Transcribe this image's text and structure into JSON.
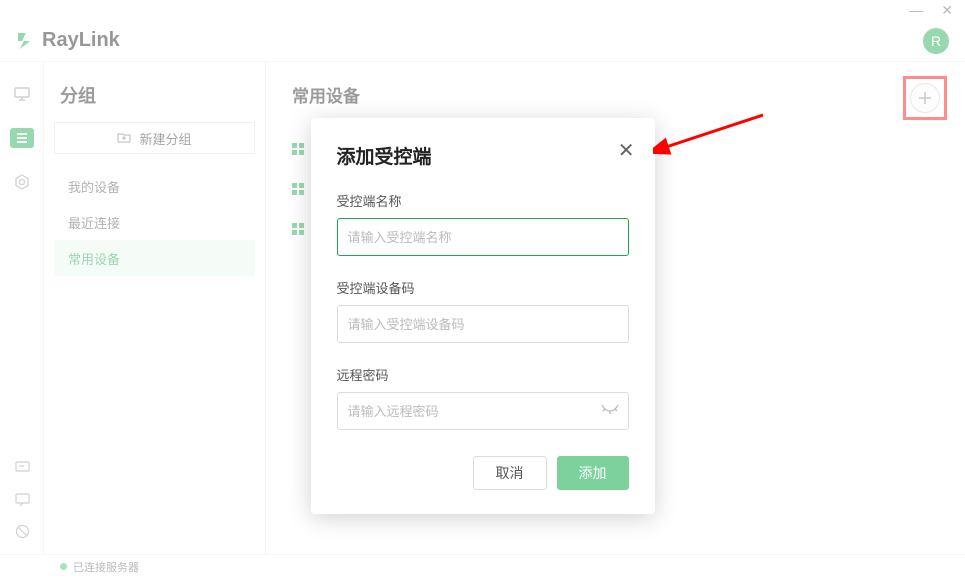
{
  "app": {
    "name": "RayLink",
    "avatar_letter": "R"
  },
  "titlebar": {
    "min": "—",
    "close": "✕"
  },
  "sidebar": {
    "title": "分组",
    "new_group": "新建分组",
    "items": [
      {
        "label": "我的设备"
      },
      {
        "label": "最近连接"
      },
      {
        "label": "常用设备"
      }
    ]
  },
  "main": {
    "title": "常用设备"
  },
  "modal": {
    "title": "添加受控端",
    "field1_label": "受控端名称",
    "field1_placeholder": "请输入受控端名称",
    "field2_label": "受控端设备码",
    "field2_placeholder": "请输入受控端设备码",
    "field3_label": "远程密码",
    "field3_placeholder": "请输入远程密码",
    "cancel": "取消",
    "confirm": "添加"
  },
  "status": {
    "text": "已连接服务器"
  }
}
